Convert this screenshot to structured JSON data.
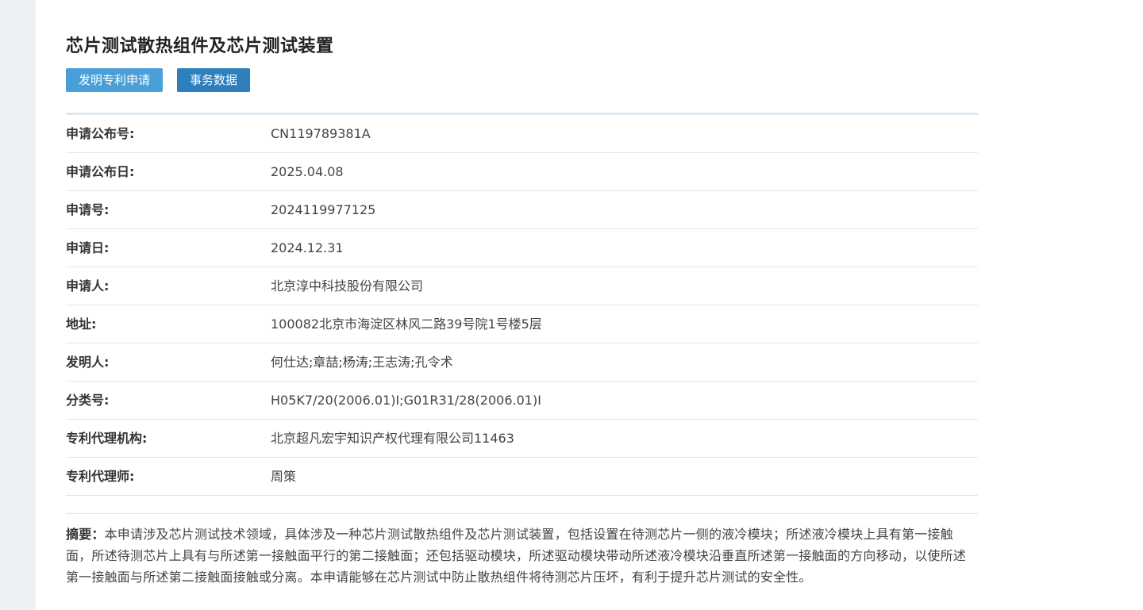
{
  "page": {
    "title": "芯片测试散热组件及芯片测试装置"
  },
  "tabs": [
    {
      "label": "发明专利申请"
    },
    {
      "label": "事务数据"
    }
  ],
  "fields": [
    {
      "label": "申请公布号:",
      "value": "CN119789381A"
    },
    {
      "label": "申请公布日:",
      "value": "2025.04.08"
    },
    {
      "label": "申请号:",
      "value": "2024119977125"
    },
    {
      "label": "申请日:",
      "value": "2024.12.31"
    },
    {
      "label": "申请人:",
      "value": "北京淳中科技股份有限公司"
    },
    {
      "label": "地址:",
      "value": "100082北京市海淀区林风二路39号院1号楼5层"
    },
    {
      "label": "发明人:",
      "value": "何仕达;章喆;杨涛;王志涛;孔令术"
    },
    {
      "label": "分类号:",
      "value": "H05K7/20(2006.01)I;G01R31/28(2006.01)I"
    },
    {
      "label": "专利代理机构:",
      "value": "北京超凡宏宇知识产权代理有限公司11463"
    },
    {
      "label": "专利代理师:",
      "value": "周策"
    }
  ],
  "abstract": {
    "label": "摘要：",
    "text": "本申请涉及芯片测试技术领域，具体涉及一种芯片测试散热组件及芯片测试装置，包括设置在待测芯片一侧的液冷模块；所述液冷模块上具有第一接触面，所述待测芯片上具有与所述第一接触面平行的第二接触面；还包括驱动模块，所述驱动模块带动所述液冷模块沿垂直所述第一接触面的方向移动，以使所述第一接触面与所述第二接触面接触或分离。本申请能够在芯片测试中防止散热组件将待测芯片压坏，有利于提升芯片测试的安全性。"
  },
  "colors": {
    "tab_primary": "#4a9fd8",
    "tab_secondary": "#2f7fbd",
    "gutter": "#eef1f4"
  }
}
